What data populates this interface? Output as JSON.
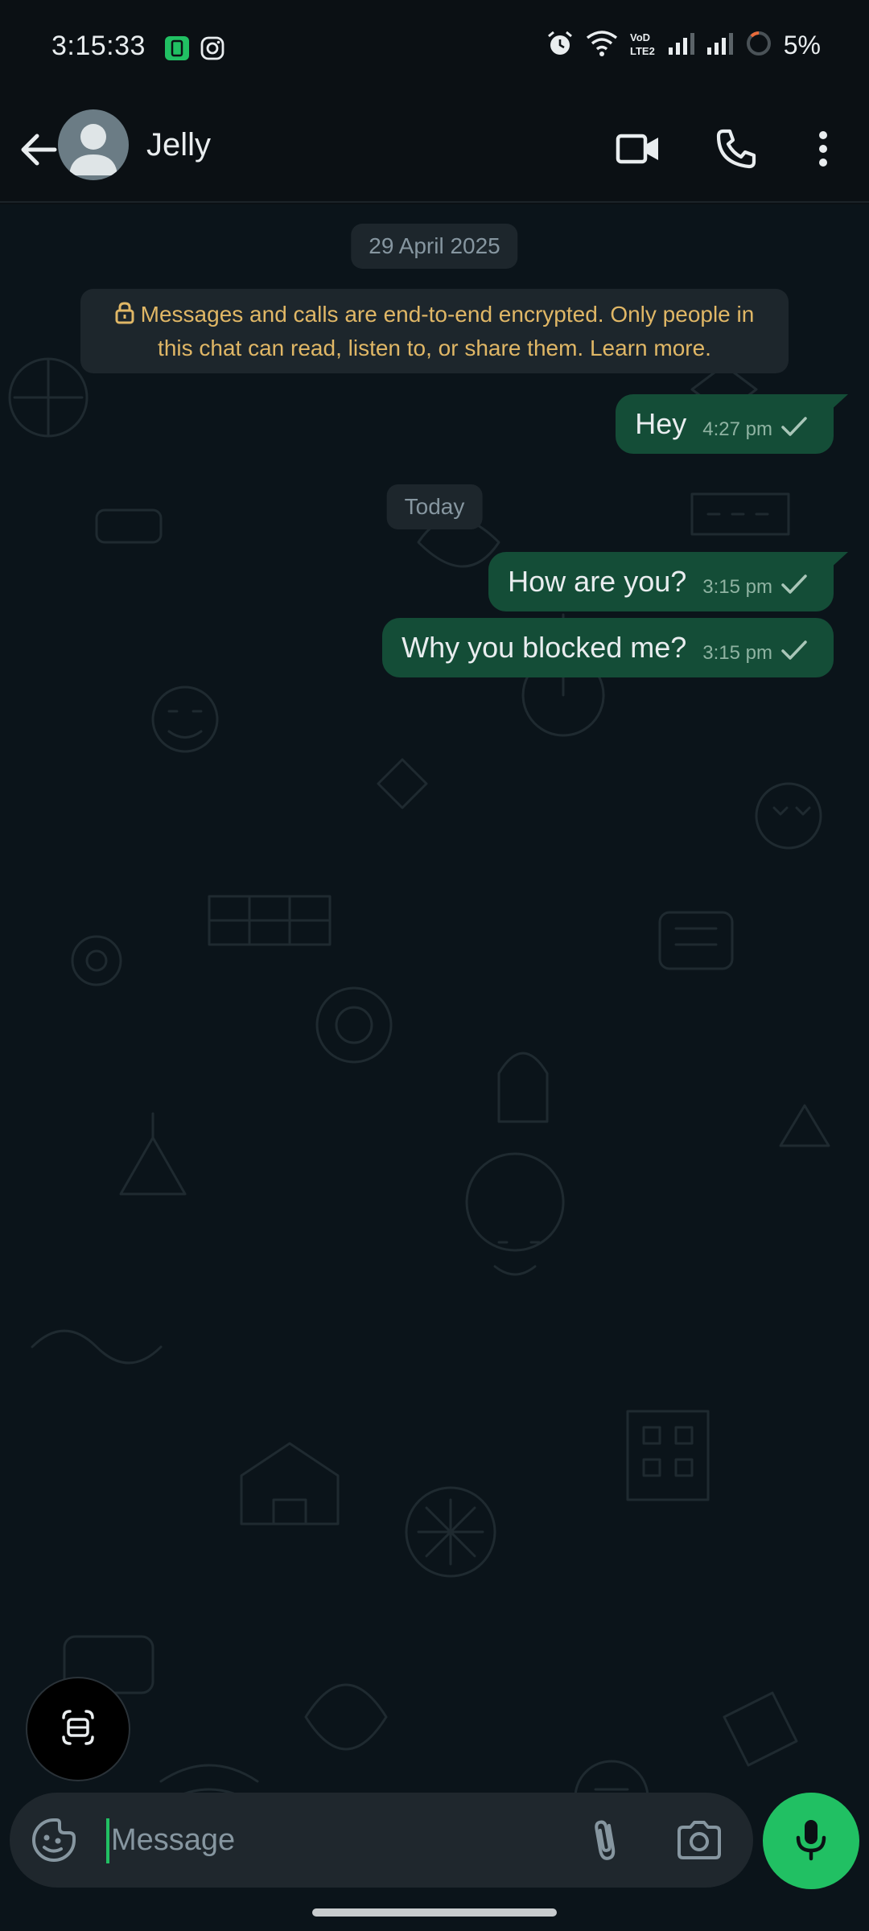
{
  "status_bar": {
    "time": "3:15:33",
    "battery": "5%",
    "icons": [
      "app-notification-icon",
      "instagram-icon",
      "alarm-icon",
      "wifi-icon",
      "volte-icon",
      "signal-icon",
      "signal-icon",
      "battery-icon"
    ]
  },
  "header": {
    "contact_name": "Jelly",
    "icons": [
      "back-arrow-icon",
      "avatar",
      "video-call-icon",
      "voice-call-icon",
      "more-vert-icon"
    ]
  },
  "chat": {
    "date_1": "29 April 2025",
    "encryption_notice": "Messages and calls are end-to-end encrypted. Only people in this chat can read, listen to, or share them. Learn more.",
    "date_2": "Today",
    "messages": [
      {
        "text": "Hey",
        "time": "4:27 pm",
        "status": "sent"
      },
      {
        "text": "How are you?",
        "time": "3:15 pm",
        "status": "sent"
      },
      {
        "text": "Why you blocked me?",
        "time": "3:15 pm",
        "status": "sent"
      }
    ]
  },
  "input": {
    "placeholder": "Message",
    "icons": [
      "sticker-icon",
      "attach-icon",
      "camera-icon",
      "mic-icon"
    ]
  },
  "colors": {
    "background": "#0b141a",
    "outgoing_bubble": "#144d37",
    "accent": "#21c063",
    "notice_text": "#e0b766"
  }
}
